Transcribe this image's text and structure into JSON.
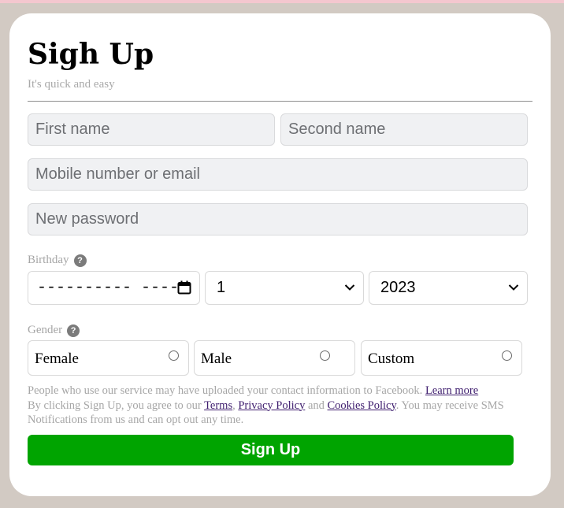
{
  "form": {
    "title": "Sigh Up",
    "subtitle": "It's quick and easy",
    "first_name_placeholder": "First name",
    "second_name_placeholder": "Second name",
    "contact_placeholder": "Mobile number or email",
    "password_placeholder": "New password",
    "birthday_label": "Birthday",
    "help_glyph": "?",
    "date_value": "----------  ----",
    "day_value": "1",
    "year_value": "2023",
    "gender_label": "Gender",
    "gender_options": [
      "Female",
      "Male",
      "Custom"
    ],
    "legal": {
      "line1": "People who use our service may have uploaded your contact information to Facebook.",
      "learn_more": "Learn more",
      "clicking": "By clicking Sign Up, you agree to our",
      "terms": "Terms",
      "privacy": "Privacy Policy",
      "and": "and",
      "cookies": "Cookies Policy",
      "sms": ". You may receive SMS Notifications from us and can opt out any time."
    },
    "submit_label": "Sign Up"
  },
  "colors": {
    "page_background": "#d2cac3",
    "card_background": "#ffffff",
    "submit_background": "#00a400",
    "link": "#3e1d6e"
  },
  "icons": [
    "help-icon",
    "calendar-icon",
    "chevron-down-icon",
    "radio-icon"
  ]
}
